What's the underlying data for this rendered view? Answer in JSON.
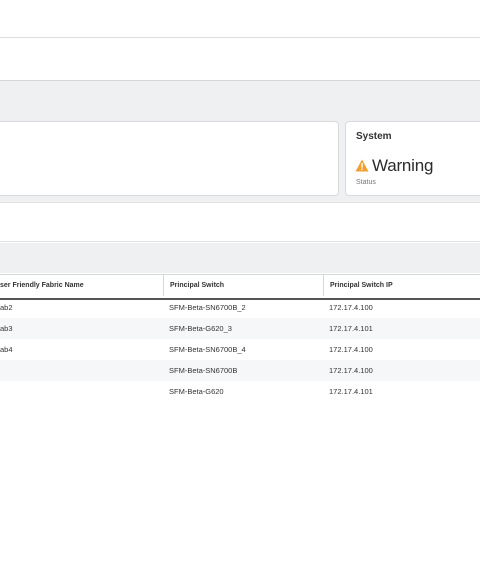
{
  "system_card": {
    "title": "System",
    "status_value": "Warning",
    "status_label": "Status",
    "warning_color": "#f0a030",
    "icon": "warning-icon"
  },
  "table": {
    "columns": [
      "ser Friendly Fabric Name",
      "Principal Switch",
      "Principal Switch IP"
    ],
    "rows": [
      [
        "ab2",
        "SFM-Beta-SN6700B_2",
        "172.17.4.100"
      ],
      [
        "ab3",
        "SFM-Beta-G620_3",
        "172.17.4.101"
      ],
      [
        "ab4",
        "SFM-Beta-SN6700B_4",
        "172.17.4.100"
      ],
      [
        "",
        "SFM-Beta-SN6700B",
        "172.17.4.100"
      ],
      [
        "",
        "SFM-Beta-G620",
        "172.17.4.101"
      ]
    ]
  }
}
